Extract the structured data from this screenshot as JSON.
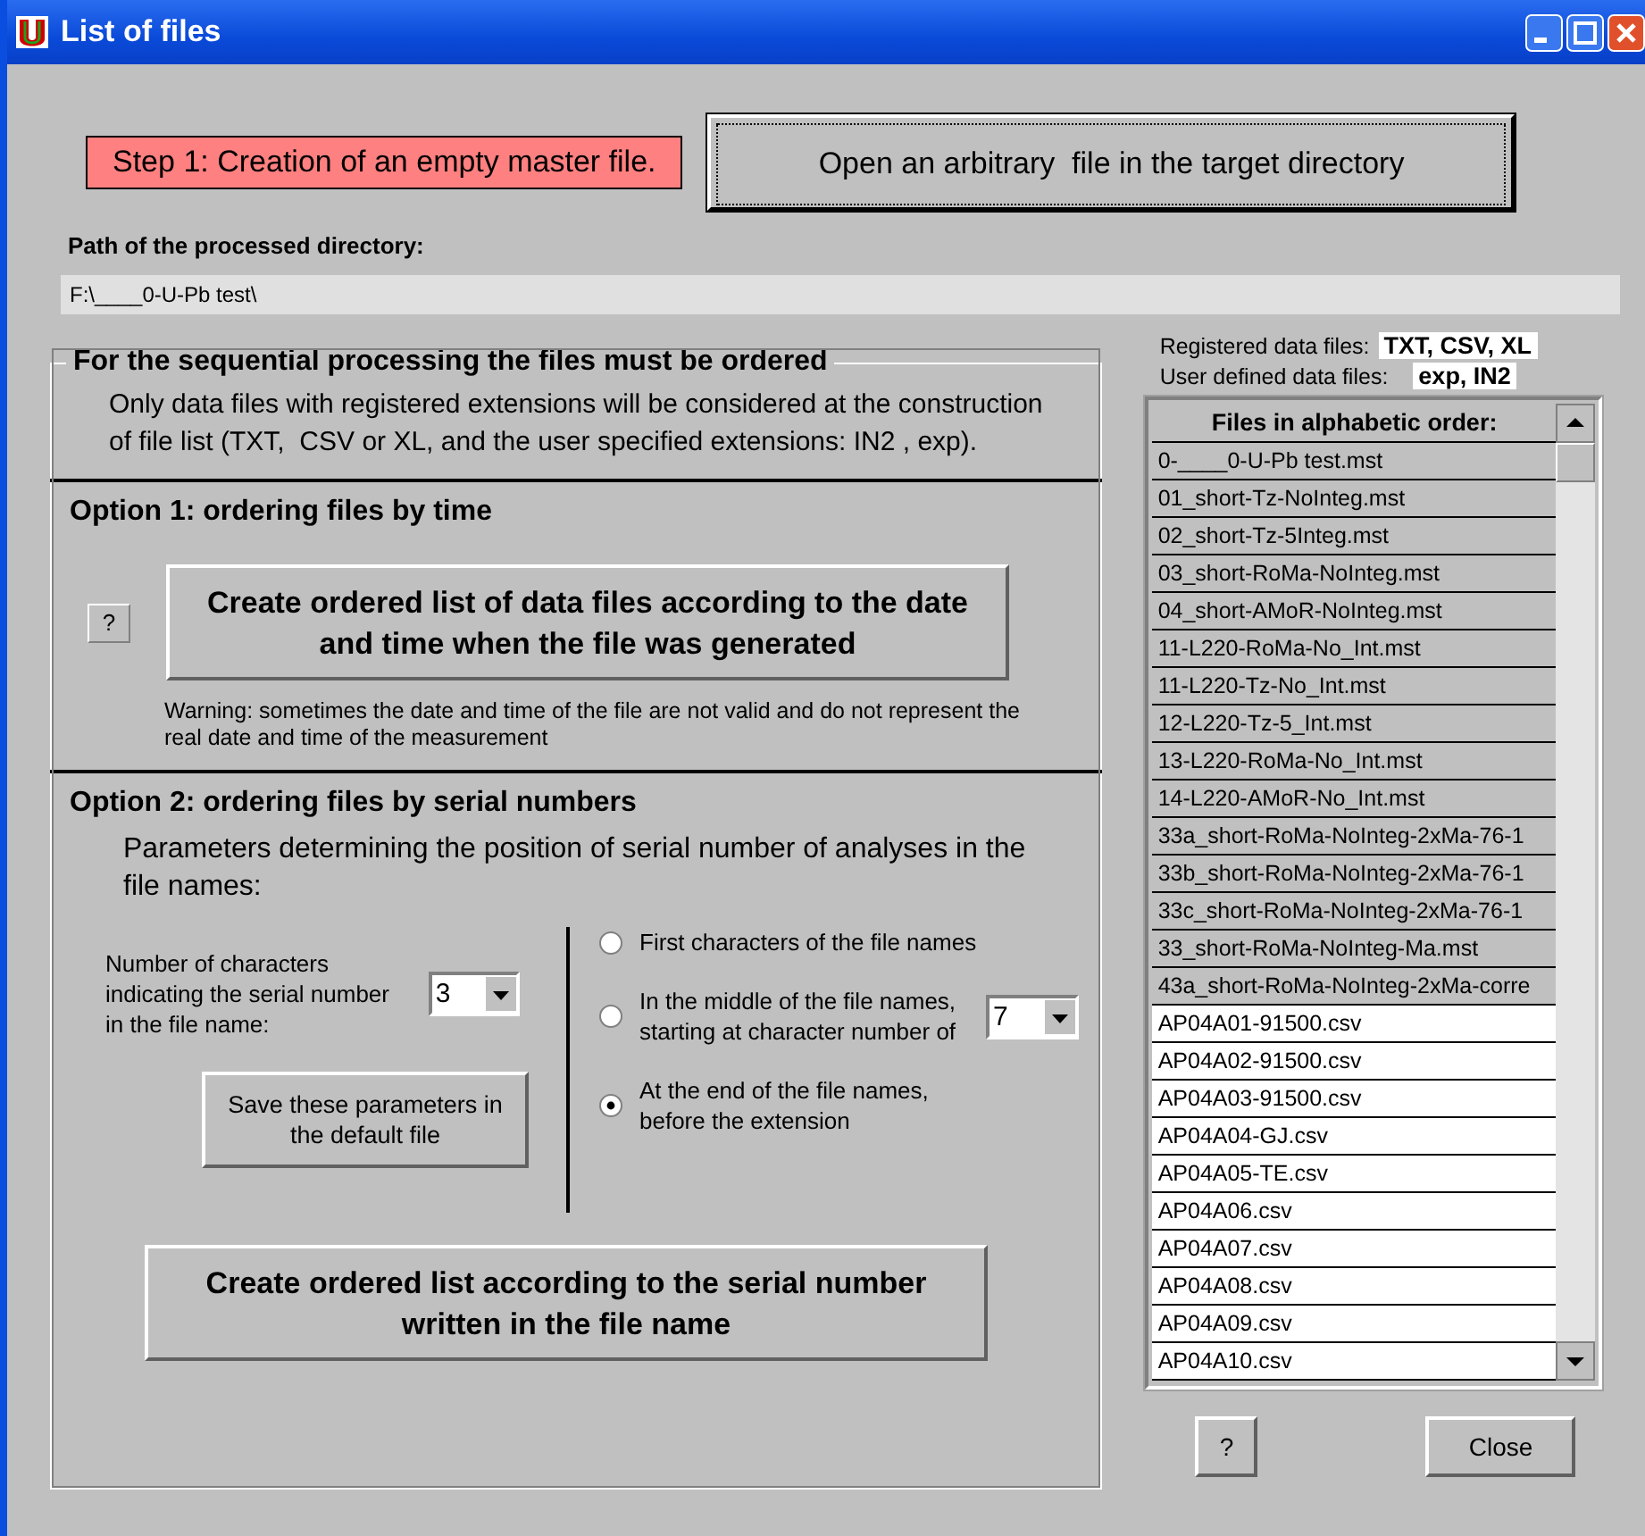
{
  "window": {
    "title": "List of files"
  },
  "step_label": "Step 1: Creation of an empty master file.",
  "open_button": "Open an arbitrary  file in the target directory",
  "path": {
    "label": "Path of the processed directory:",
    "value": "F:\\____0-U-Pb test\\"
  },
  "ordering": {
    "title": "For the sequential processing the files must be ordered",
    "description": "Only data files with registered extensions will be considered at the construction of file list (TXT,  CSV or XL, and the user specified extensions: IN2 , exp).",
    "option1": {
      "title": "Option 1: ordering files by time",
      "help_button": "?",
      "button": "Create ordered list of data files according to the date and time when the file was generated",
      "warning": "Warning: sometimes the date and time of the file are not valid and do not represent the real date and time of the measurement"
    },
    "option2": {
      "title": "Option 2: ordering files by serial numbers",
      "description": "Parameters determining the position of serial number of analyses in the file names:",
      "char_count": {
        "label": "Number of characters indicating the serial number in the file name:",
        "value": "3"
      },
      "save_button": "Save these parameters in the default file",
      "positions": [
        {
          "label": "First characters of the file names",
          "selected": false
        },
        {
          "label": "In the middle of the file names, starting at character number of",
          "selected": false,
          "dropdown": "7"
        },
        {
          "label": "At the end of the file names, before the extension",
          "selected": true
        }
      ],
      "button": "Create ordered list according to the serial number written in the file name"
    }
  },
  "registered": {
    "label": "Registered data files:",
    "value": "TXT, CSV, XL"
  },
  "user_defined": {
    "label": "User defined data files:",
    "value": "exp, IN2"
  },
  "file_list": {
    "header": "Files in alphabetic order:",
    "rows": [
      {
        "name": "0-____0-U-Pb test.mst",
        "kind": "master"
      },
      {
        "name": "01_short-Tz-NoInteg.mst",
        "kind": "master"
      },
      {
        "name": "02_short-Tz-5Integ.mst",
        "kind": "master"
      },
      {
        "name": "03_short-RoMa-NoInteg.mst",
        "kind": "master"
      },
      {
        "name": "04_short-AMoR-NoInteg.mst",
        "kind": "master"
      },
      {
        "name": "11-L220-RoMa-No_Int.mst",
        "kind": "master"
      },
      {
        "name": "11-L220-Tz-No_Int.mst",
        "kind": "master"
      },
      {
        "name": "12-L220-Tz-5_Int.mst",
        "kind": "master"
      },
      {
        "name": "13-L220-RoMa-No_Int.mst",
        "kind": "master"
      },
      {
        "name": "14-L220-AMoR-No_Int.mst",
        "kind": "master"
      },
      {
        "name": "33a_short-RoMa-NoInteg-2xMa-76-1",
        "kind": "master"
      },
      {
        "name": "33b_short-RoMa-NoInteg-2xMa-76-1",
        "kind": "master"
      },
      {
        "name": "33c_short-RoMa-NoInteg-2xMa-76-1",
        "kind": "master"
      },
      {
        "name": "33_short-RoMa-NoInteg-Ma.mst",
        "kind": "master"
      },
      {
        "name": "43a_short-RoMa-NoInteg-2xMa-corre",
        "kind": "master"
      },
      {
        "name": "AP04A01-91500.csv",
        "kind": "data"
      },
      {
        "name": "AP04A02-91500.csv",
        "kind": "data"
      },
      {
        "name": "AP04A03-91500.csv",
        "kind": "data"
      },
      {
        "name": "AP04A04-GJ.csv",
        "kind": "data"
      },
      {
        "name": "AP04A05-TE.csv",
        "kind": "data"
      },
      {
        "name": "AP04A06.csv",
        "kind": "data"
      },
      {
        "name": "AP04A07.csv",
        "kind": "data"
      },
      {
        "name": "AP04A08.csv",
        "kind": "data"
      },
      {
        "name": "AP04A09.csv",
        "kind": "data"
      },
      {
        "name": "AP04A10.csv",
        "kind": "data"
      }
    ]
  },
  "buttons": {
    "help": "?",
    "close": "Close"
  }
}
